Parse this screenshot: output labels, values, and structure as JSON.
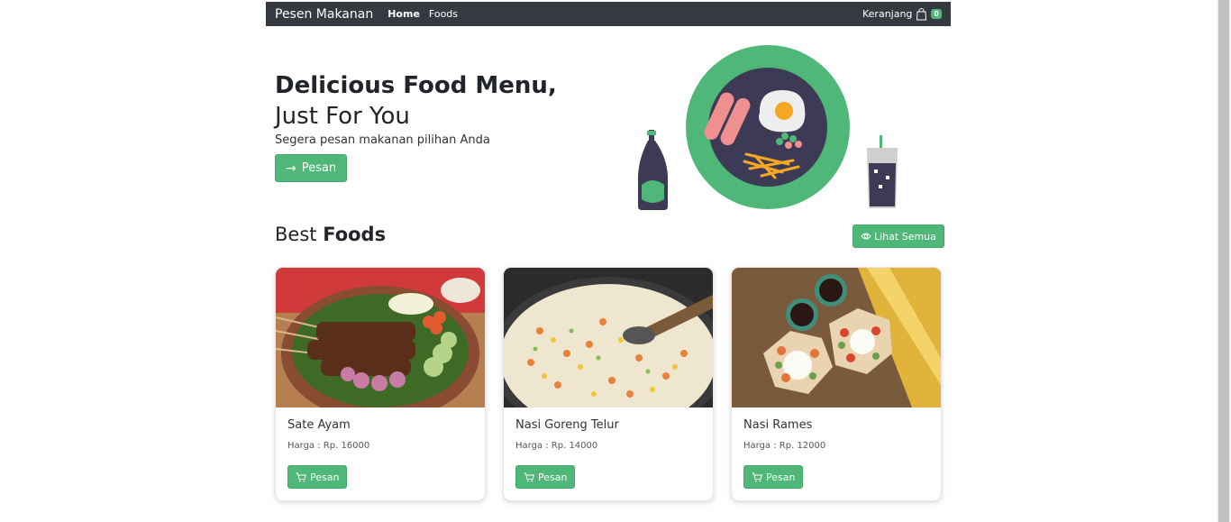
{
  "navbar": {
    "brand": "Pesen Makanan",
    "links": [
      "Home",
      "Foods"
    ],
    "cart_label": "Keranjang",
    "cart_count": "0"
  },
  "hero": {
    "title_bold": "Delicious Food Menu,",
    "title_light": "Just For You",
    "subtitle": "Segera pesan makanan pilihan Anda",
    "button_label": "Pesan"
  },
  "best": {
    "title_light": "Best",
    "title_bold": "Foods",
    "see_all_label": "Lihat Semua"
  },
  "foods": [
    {
      "name": "Sate Ayam",
      "price": "Harga : Rp. 16000",
      "button": "Pesan"
    },
    {
      "name": "Nasi Goreng Telur",
      "price": "Harga : Rp. 14000",
      "button": "Pesan"
    },
    {
      "name": "Nasi Rames",
      "price": "Harga : Rp. 12000",
      "button": "Pesan"
    }
  ],
  "colors": {
    "accent": "#4fb878",
    "navbar": "#343a40",
    "plate_dark": "#3c3a55"
  }
}
